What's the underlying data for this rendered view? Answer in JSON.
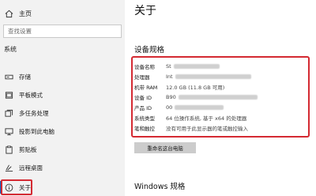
{
  "sidebar": {
    "home_label": "主页",
    "search_placeholder": "查找设置",
    "section_label": "系统",
    "items": [
      {
        "label": "存储",
        "icon": "storage-icon"
      },
      {
        "label": "平板模式",
        "icon": "tablet-mode-icon"
      },
      {
        "label": "多任务处理",
        "icon": "multitasking-icon"
      },
      {
        "label": "投影到此电脑",
        "icon": "project-icon"
      },
      {
        "label": "剪贴板",
        "icon": "clipboard-icon"
      },
      {
        "label": "远程桌面",
        "icon": "remote-desktop-icon"
      },
      {
        "label": "关于",
        "icon": "info-icon",
        "active": true
      }
    ]
  },
  "main": {
    "title": "关于",
    "device_specs_title": "设备规格",
    "specs": [
      {
        "key": "设备名称",
        "value": "St"
      },
      {
        "key": "处理器",
        "value": "Int"
      },
      {
        "key": "机带 RAM",
        "value": "12.0 GB (11.8 GB 可用)"
      },
      {
        "key": "设备 ID",
        "value": "B90"
      },
      {
        "key": "产品 ID",
        "value": "00"
      },
      {
        "key": "系统类型",
        "value": "64 位操作系统, 基于 x64 的处理器"
      },
      {
        "key": "笔和触控",
        "value": "没有可用于此显示器的笔或触控输入"
      }
    ],
    "rename_button": "重命名这台电脑",
    "windows_specs_title": "Windows 规格"
  },
  "colors": {
    "accent": "#0a66c2",
    "highlight_box": "#d42a32",
    "sidebar_bg": "#f2f2f2"
  }
}
